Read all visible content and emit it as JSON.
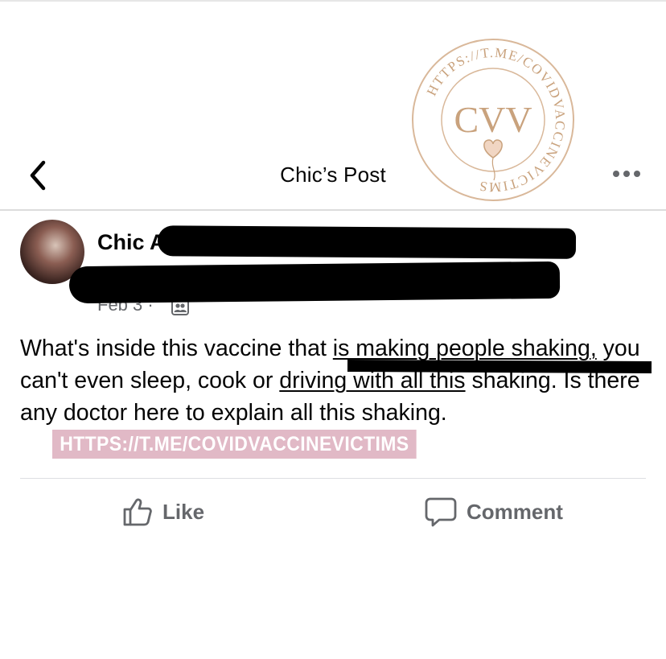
{
  "header": {
    "title": "Chic’s Post",
    "back_icon": "chevron-left-icon",
    "more_icon": "more-horizontal-icon"
  },
  "watermark": {
    "monogram": "CVV",
    "ring_text": "HTTPS://T.ME/COVIDVACCINEVICTIMS",
    "color": "#c9a27d"
  },
  "post": {
    "author_name": "Chic A",
    "date": "Feb 3 ·",
    "privacy_icon": "friends-icon",
    "text_lead": "What's inside this vaccine that ",
    "text_underlined": "is making people shaking,",
    "text_rest_1": " you can't even sleep, cook or ",
    "text_underlined_2": "driving with all this",
    "text_rest_2": " shaking. Is there any doctor here to explain all this shaking.",
    "link_text": "HTTPS://T.ME/COVIDVACCINEVICTIMS",
    "link_bg": "#e1b9c6"
  },
  "actions": {
    "like_label": "Like",
    "like_icon": "thumbs-up-icon",
    "comment_label": "Comment",
    "comment_icon": "comment-bubble-icon",
    "label_color": "#65676b"
  }
}
